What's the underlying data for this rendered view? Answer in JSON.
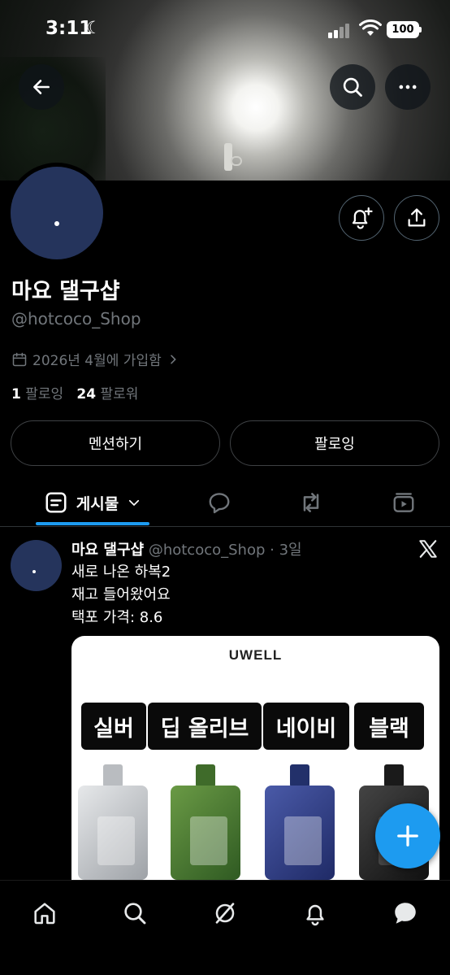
{
  "status_bar": {
    "time": "3:11",
    "battery": "100"
  },
  "header": {
    "back_icon": "arrow-left-icon",
    "search_icon": "search-icon",
    "more_icon": "more-horizontal-icon",
    "notify_icon": "bell-plus-icon",
    "share_icon": "share-icon"
  },
  "profile": {
    "name": "마요 댈구샵",
    "handle": "@hotcoco_Shop",
    "joined": "2026년 4월에 가입함",
    "following_count": "1",
    "following_label": "팔로잉",
    "followers_count": "24",
    "followers_label": "팔로워",
    "mention_button": "멘션하기",
    "follow_button": "팔로잉"
  },
  "tabs": {
    "posts_label": "게시물"
  },
  "post": {
    "name": "마요 댈구샵",
    "handle": "@hotcoco_Shop",
    "time": "3일",
    "lines": [
      "새로 나온 하복2",
      "재고 들어왔어요",
      "택포 가격: 8.6"
    ],
    "media": {
      "brand": "UWELL",
      "labels": [
        "실버",
        "딥 올리브",
        "네이비",
        "블랙"
      ]
    }
  },
  "colors": {
    "accent": "#1d9bf0",
    "avatar": "#25345c",
    "muted": "#71767b"
  }
}
